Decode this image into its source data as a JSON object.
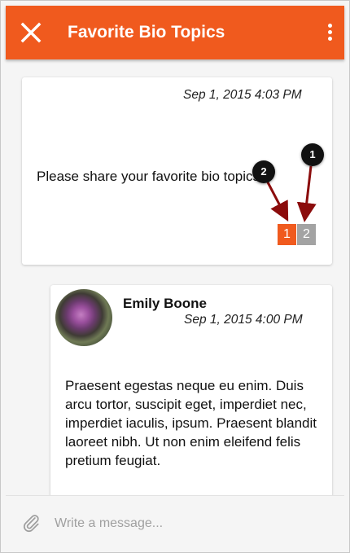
{
  "header": {
    "title": "Favorite Bio Topics",
    "close_icon": "close-icon",
    "menu_icon": "more-vert-icon",
    "color": "#f05a1e"
  },
  "conversation": {
    "first_message": {
      "timestamp": "Sep 1, 2015 4:03 PM",
      "text": "Please share your favorite bio topics.",
      "badges": [
        "1",
        "2"
      ]
    },
    "reply": {
      "author": "Emily Boone",
      "timestamp": "Sep 1, 2015 4:00 PM",
      "text": "Praesent egestas neque eu enim. Duis arcu tortor, suscipit eget, imperdiet nec, imperdiet iaculis, ipsum. Praesent blandit laoreet nibh. Ut non enim eleifend felis pretium feugiat."
    }
  },
  "composer": {
    "placeholder": "Write a message...",
    "attach_icon": "paperclip-icon"
  },
  "annotations": {
    "callout_1": "1",
    "callout_2": "2"
  }
}
